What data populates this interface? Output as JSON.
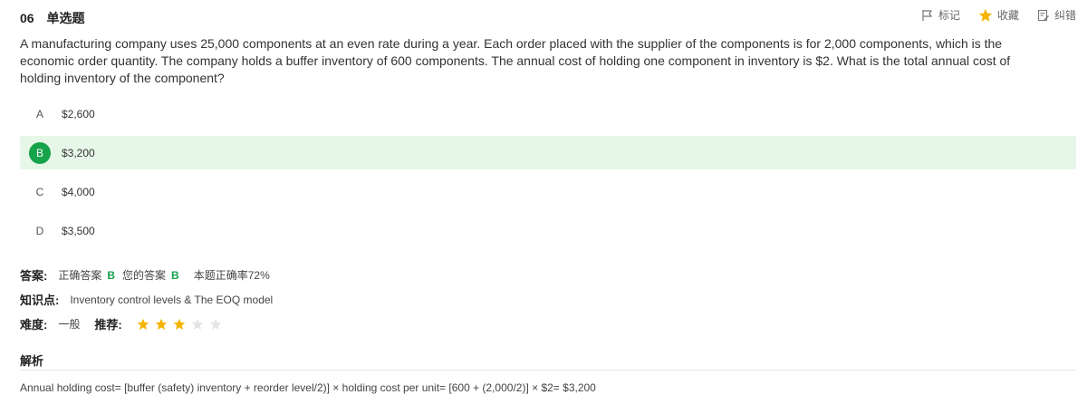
{
  "header": {
    "number": "06",
    "type": "单选题",
    "actions": {
      "mark": "标记",
      "favorite": "收藏",
      "report": "纠错"
    }
  },
  "question": {
    "text": "A manufacturing company uses 25,000 components at an even rate during a year. Each order placed with the supplier of the components is for 2,000 components, which is the economic order quantity. The company holds a buffer inventory of 600 components. The annual cost of holding one component in inventory is $2. What is the total annual cost of holding inventory of the component?"
  },
  "options": [
    {
      "letter": "A",
      "text": "$2,600"
    },
    {
      "letter": "B",
      "text": "$3,200",
      "state": "correct"
    },
    {
      "letter": "C",
      "text": "$4,000"
    },
    {
      "letter": "D",
      "text": "$3,500"
    }
  ],
  "answer": {
    "label": "答案:",
    "correct_label": "正确答案",
    "correct_value": "B",
    "yours_label": "您的答案",
    "yours_value": "B",
    "accuracy": "本题正确率72%"
  },
  "knowledge": {
    "label": "知识点:",
    "value": "Inventory control levels & The EOQ model"
  },
  "difficulty": {
    "label": "难度:",
    "value": "一般",
    "recommend_label": "推荐:",
    "stars_filled": 3,
    "stars_total": 5
  },
  "analysis": {
    "title": "解析",
    "text": "Annual holding cost= [buffer (safety) inventory + reorder level/2)] × holding cost per unit= [600 + (2,000/2)] × $2= $3,200"
  },
  "colors": {
    "correct_green": "#16a34a",
    "correct_bg": "#e6f7e7",
    "star_gold": "#f5b400",
    "star_empty": "#e5e5e5"
  }
}
